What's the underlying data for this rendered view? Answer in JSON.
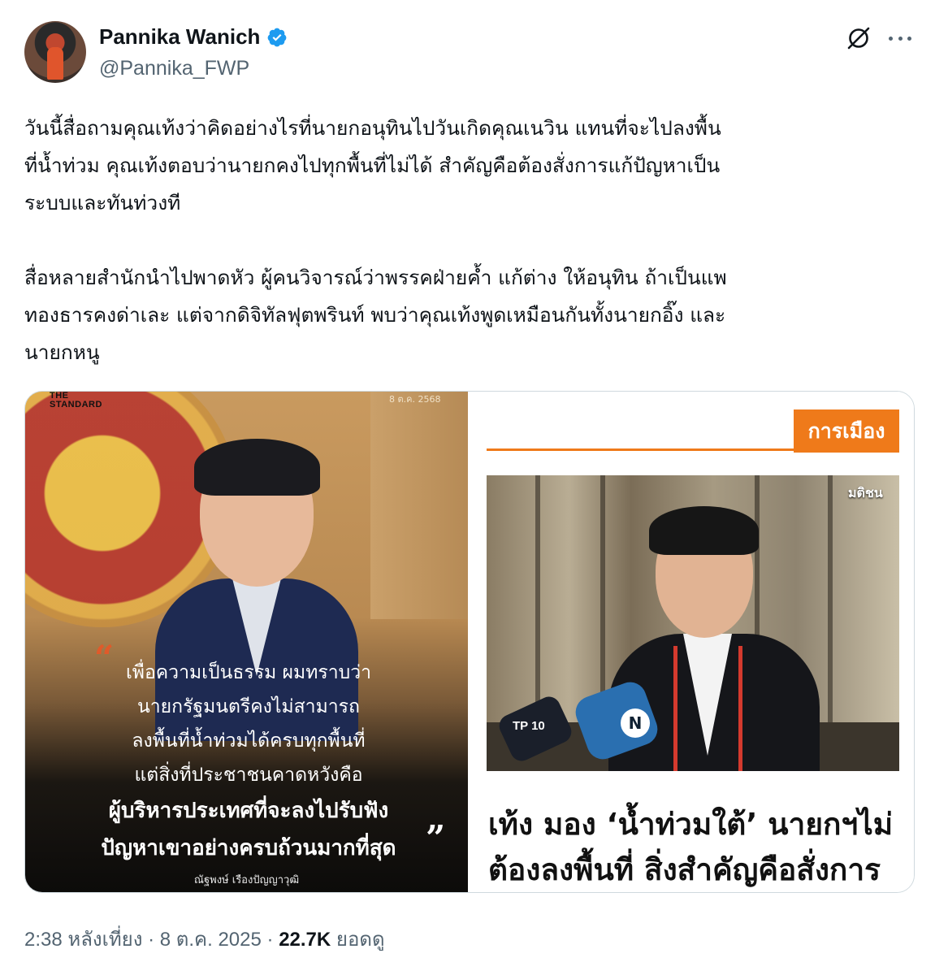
{
  "author": {
    "display_name": "Pannika Wanich",
    "handle": "@Pannika_FWP",
    "verified": true,
    "verified_color": "#1d9bf0"
  },
  "actions": {
    "grok_icon": "grok-icon",
    "more_icon": "more-dots-icon"
  },
  "tweet": {
    "paragraph1": [
      "วันนี้สื่อถามคุณเท้งว่าคิดอย่างไรที่นายกอนุทินไปวันเกิดคุณเนวิน แทนที่จะไปลงพื้น",
      "ที่น้ำท่วม คุณเท้งตอบว่านายกคงไปทุกพื้นที่ไม่ได้ สำคัญคือต้องสั่งการแก้ปัญหาเป็น",
      "ระบบและทันท่วงที"
    ],
    "paragraph2": [
      "สื่อหลายสำนักนำไปพาดหัว ผู้คนวิจารณ์ว่าพรรคฝ่ายค้ำ แก้ต่าง ให้อนุทิน ถ้าเป็นแพ",
      "ทองธารคงด่าเละ แต่จากดิจิทัลฟุตพรินท์ พบว่าคุณเท้งพูดเหมือนกันทั้งนายกอิ๊ง และ",
      "นายกหนู"
    ]
  },
  "media": {
    "left": {
      "logo_line1": "THE",
      "logo_line2": "STANDARD",
      "date": "8 ต.ค. 2568",
      "quote_lines": [
        "เพื่อความเป็นธรรม ผมทราบว่า",
        "นายกรัฐมนตรีคงไม่สามารถ",
        "ลงพื้นที่น้ำท่วมได้ครบทุกพื้นที่",
        "แต่สิ่งที่ประชาชนคาดหวังคือ"
      ],
      "quote_bold_lines": [
        "ผู้บริหารประเทศที่จะลงไปรับฟัง",
        "ปัญหาเขาอย่างครบถ้วนมากที่สุด"
      ],
      "quote_author": "ณัฐพงษ์ เรืองปัญญาวุฒิ"
    },
    "right": {
      "section_tag": "การเมือง",
      "source_watermark": "มติชน",
      "mic_label": "TP 10",
      "mic_n": "N",
      "headline_line1": "เท้ง มอง ‘น้ำท่วมใต้’ นายกฯไม่",
      "headline_line2": "ต้องลงพื้นที่ สิ่งสำคัญคือสั่งการ"
    }
  },
  "meta": {
    "time": "2:38 หลังเที่ยง",
    "date": "8 ต.ค. 2025",
    "views_count": "22.7K",
    "views_label": "ยอดดู",
    "separator": "·"
  }
}
